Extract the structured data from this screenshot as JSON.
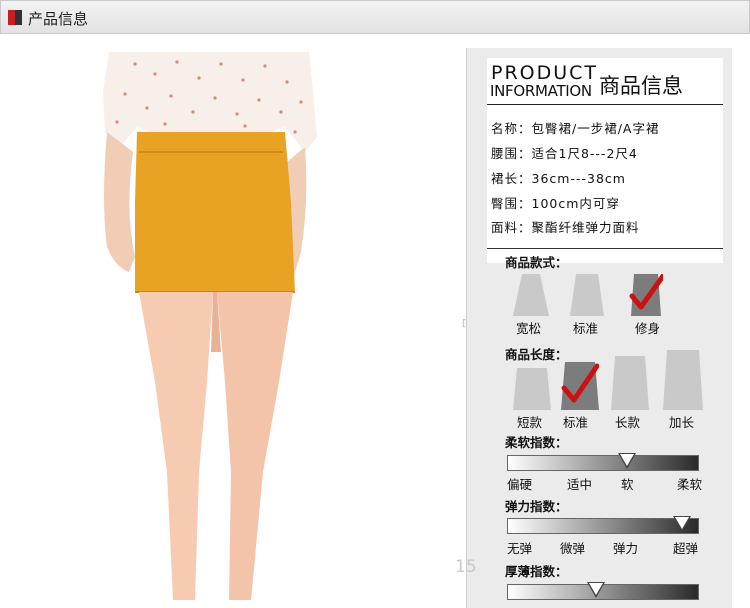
{
  "header": {
    "title": "产品信息"
  },
  "panel": {
    "title_en_1": "PRODUCT",
    "title_en_2": "INFORMATION",
    "title_cn": "商品信息",
    "specs": [
      "名称：包臀裙/一步裙/A字裙",
      "腰围：适合1尺8---2尺4",
      "裙长：36cm---38cm",
      "臀围：100cm内可穿",
      "面料：聚酯纤维弹力面料"
    ],
    "style": {
      "title": "商品款式：",
      "options": [
        "宽松",
        "标准",
        "修身"
      ],
      "selected": "修身"
    },
    "length": {
      "title": "商品长度：",
      "options": [
        "短款",
        "标准",
        "长款",
        "加长"
      ],
      "selected": "标准"
    },
    "softness": {
      "title": "柔软指数：",
      "labels": [
        "偏硬",
        "适中",
        "软",
        "柔软"
      ],
      "level": 0.63
    },
    "elasticity": {
      "title": "弹力指数：",
      "labels": [
        "无弹",
        "微弹",
        "弹力",
        "超弹"
      ],
      "level": 0.92
    },
    "thickness": {
      "title": "厚薄指数：",
      "level": 0.47
    }
  },
  "watermark": "15",
  "colors": {
    "accent_red": "#c81e1e",
    "check_red": "#cc1111",
    "skirt": "#e8a325"
  }
}
